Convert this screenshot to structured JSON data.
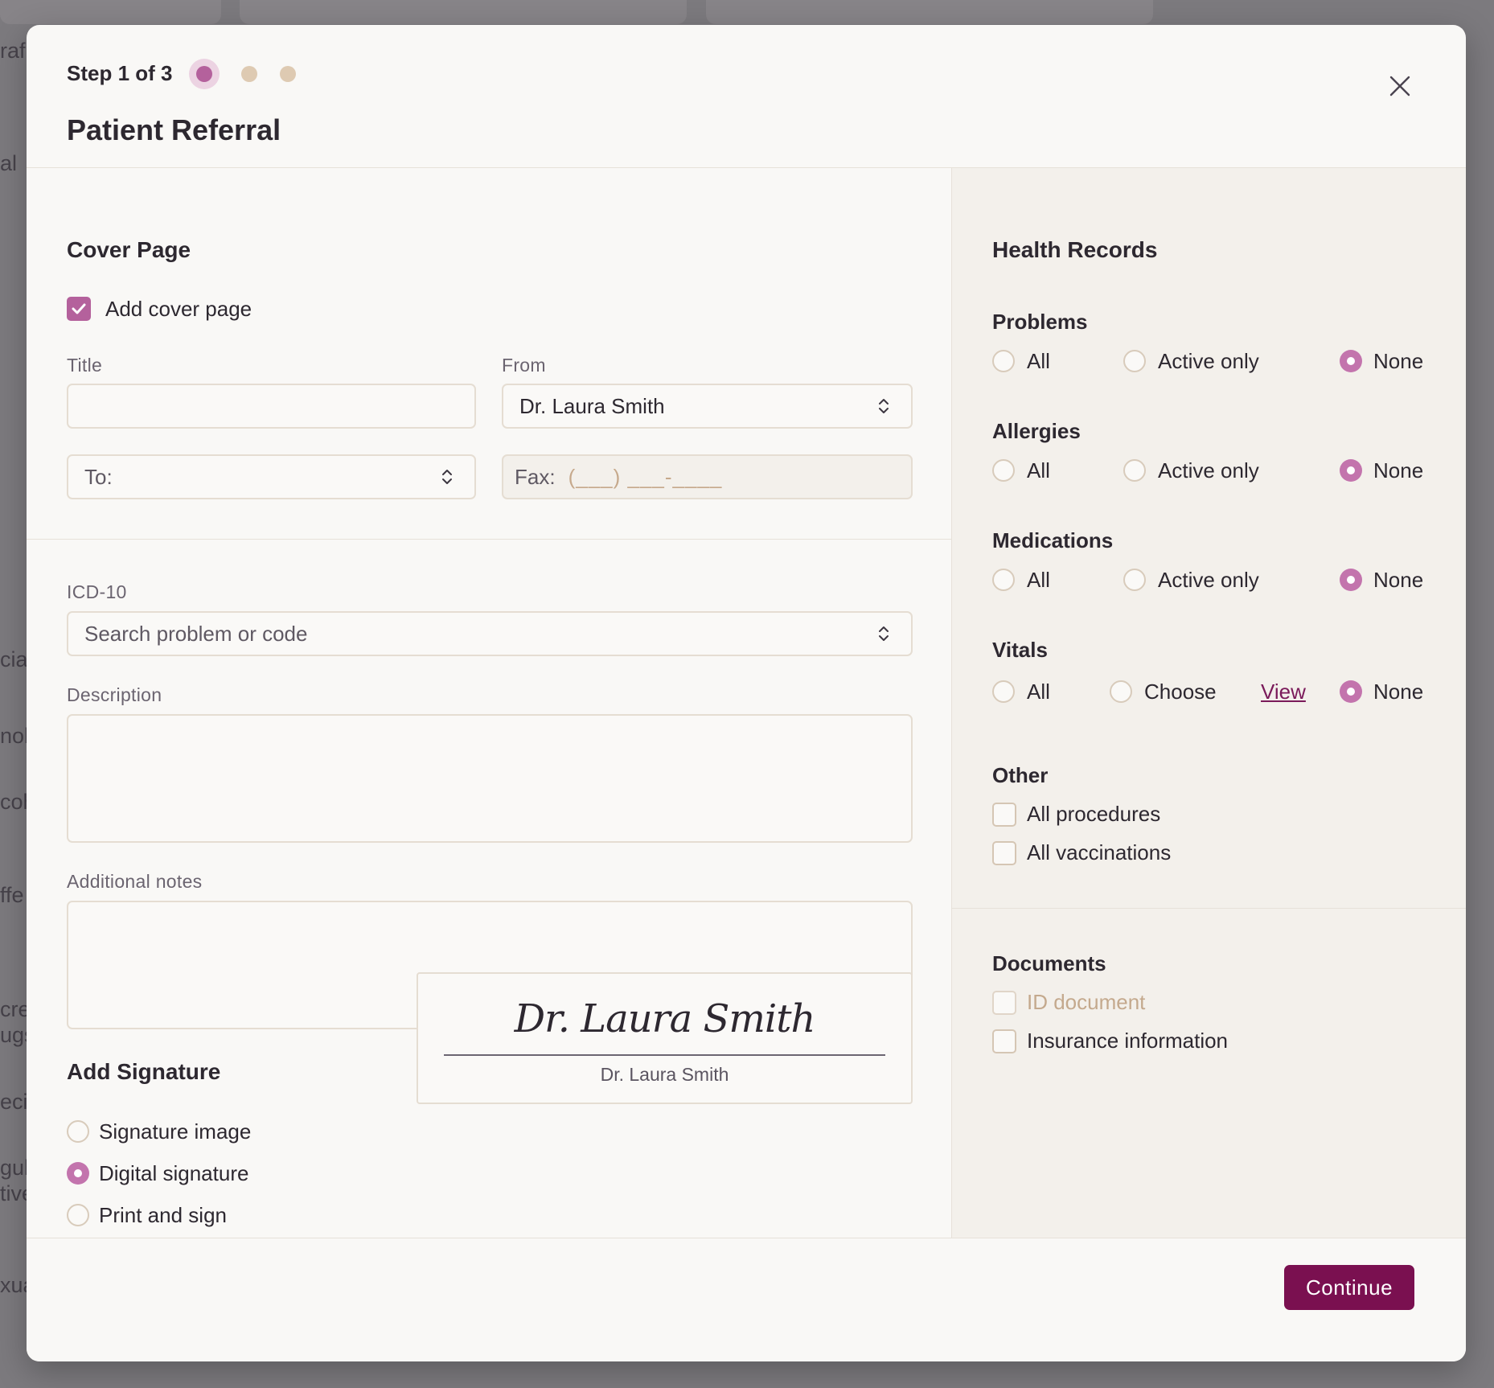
{
  "background": {
    "fragments": [
      "raf",
      "al",
      "cia",
      "nok",
      "coh",
      "ffe",
      "cre",
      "ugs",
      "eci",
      "gul",
      "tive",
      "xua"
    ]
  },
  "header": {
    "step_text": "Step 1 of 3",
    "title": "Patient Referral",
    "total_steps": 3,
    "current_step": 1
  },
  "cover_page": {
    "section_title": "Cover Page",
    "add_cover_label": "Add cover page",
    "add_cover_checked": true,
    "title_label": "Title",
    "title_value": "",
    "from_label": "From",
    "from_value": "Dr. Laura Smith",
    "to_placeholder": "To:",
    "fax_prefix": "Fax:",
    "fax_mask": "(___) ___-____"
  },
  "details": {
    "icd_label": "ICD-10",
    "icd_placeholder": "Search problem or code",
    "description_label": "Description",
    "description_value": "",
    "notes_label": "Additional notes",
    "notes_value": ""
  },
  "signature": {
    "section_title": "Add Signature",
    "options": [
      "Signature image",
      "Digital signature",
      "Print and sign"
    ],
    "selected": "Digital signature",
    "script_name": "Dr. Laura Smith",
    "printed_name": "Dr. Laura Smith"
  },
  "health_records": {
    "section_title": "Health Records",
    "problems": {
      "label": "Problems",
      "opt_all": "All",
      "opt_active": "Active only",
      "opt_none": "None",
      "selected": "None"
    },
    "allergies": {
      "label": "Allergies",
      "opt_all": "All",
      "opt_active": "Active only",
      "opt_none": "None",
      "selected": "None"
    },
    "medications": {
      "label": "Medications",
      "opt_all": "All",
      "opt_active": "Active only",
      "opt_none": "None",
      "selected": "None"
    },
    "vitals": {
      "label": "Vitals",
      "opt_all": "All",
      "opt_choose": "Choose",
      "view_link": "View",
      "opt_none": "None",
      "selected": "None"
    },
    "other": {
      "label": "Other",
      "procedures": "All procedures",
      "vaccinations": "All vaccinations"
    }
  },
  "documents": {
    "section_title": "Documents",
    "id_document": "ID document",
    "insurance": "Insurance information"
  },
  "footer": {
    "continue_label": "Continue"
  },
  "colors": {
    "accent": "#b4619c",
    "primary_button": "#7a1050",
    "link": "#7a1a5a"
  }
}
